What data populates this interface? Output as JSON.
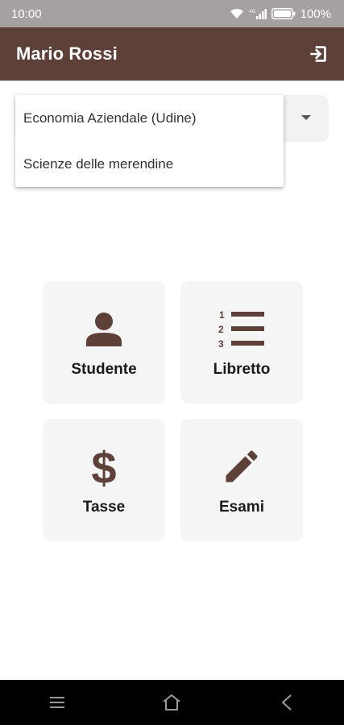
{
  "status_bar": {
    "time": "10:00",
    "battery_percent": "100%",
    "icons": [
      "wifi-icon",
      "signal-icon",
      "battery-icon"
    ]
  },
  "app_bar": {
    "title": "Mario Rossi",
    "action_icon": "logout-icon"
  },
  "course_select": {
    "options": [
      "Economia Aziendale (Udine)",
      "Scienze delle merendine"
    ]
  },
  "tiles": [
    {
      "label": "Studente",
      "icon": "person-icon"
    },
    {
      "label": "Libretto",
      "icon": "numbered-list-icon"
    },
    {
      "label": "Tasse",
      "icon": "dollar-icon"
    },
    {
      "label": "Esami",
      "icon": "pencil-icon"
    }
  ],
  "nav_bar": {
    "buttons": [
      "menu-icon",
      "home-icon",
      "back-icon"
    ]
  },
  "colors": {
    "primary": "#5d4037",
    "status_bar": "#a7a0a0",
    "tile_background": "#f5f5f5"
  }
}
